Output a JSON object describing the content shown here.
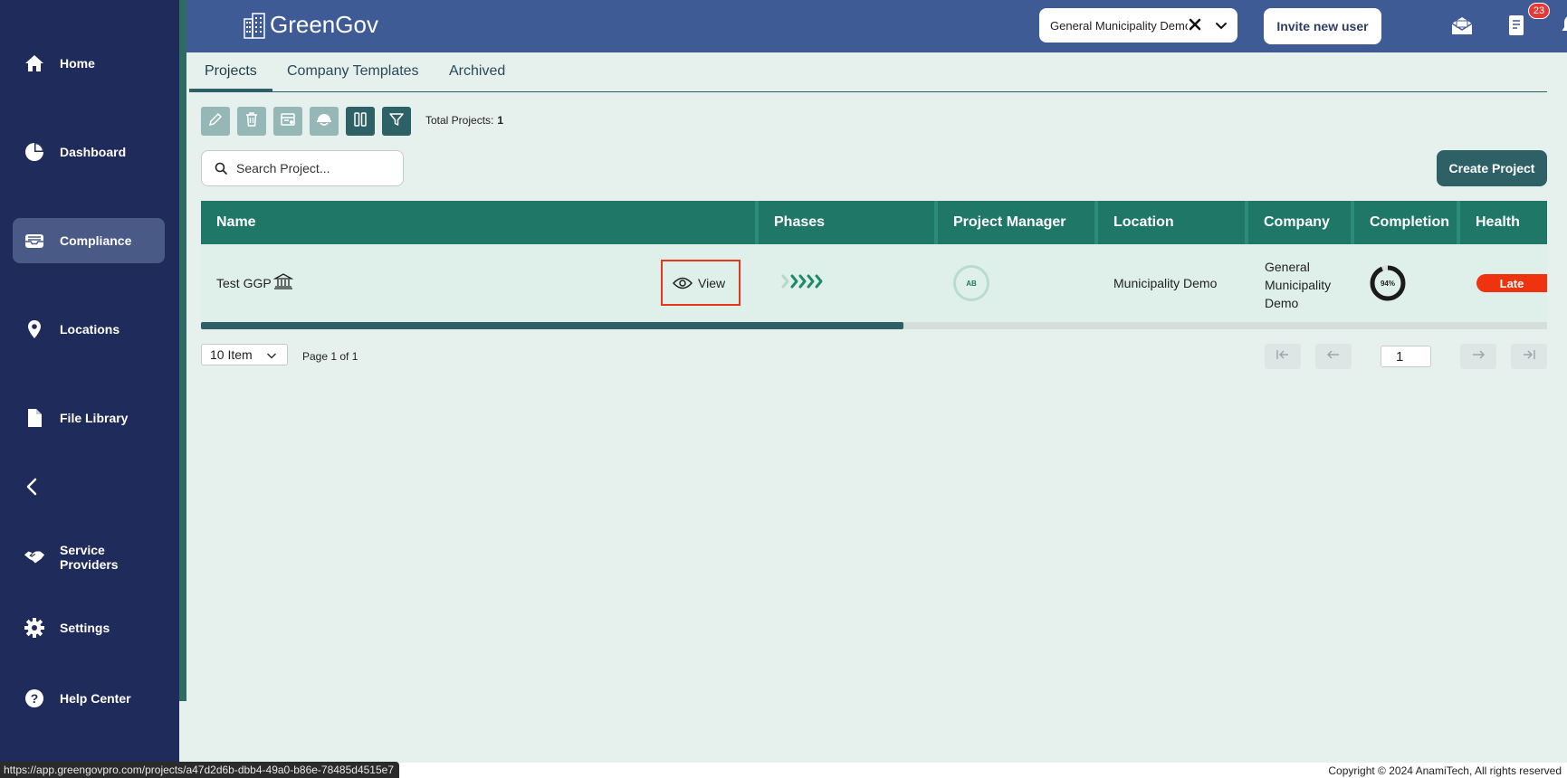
{
  "sidebar": {
    "items": [
      {
        "label": "Home",
        "icon": "home-icon"
      },
      {
        "label": "Dashboard",
        "icon": "pie-chart-icon"
      },
      {
        "label": "Compliance",
        "icon": "inbox-tray-icon"
      },
      {
        "label": "Locations",
        "icon": "map-pin-icon"
      },
      {
        "label": "File Library",
        "icon": "file-icon"
      },
      {
        "label": "Service Providers",
        "icon": "handshake-icon"
      },
      {
        "label": "Settings",
        "icon": "gear-icon"
      },
      {
        "label": "Help Center",
        "icon": "help-circle-icon"
      }
    ],
    "active": "Compliance"
  },
  "header": {
    "logo_text": "GreenGov",
    "org_select_value": "General Municipality Demo",
    "invite_label": "Invite new user",
    "notification_count": "23"
  },
  "tabs": [
    "Projects",
    "Company Templates",
    "Archived"
  ],
  "toolbar": {
    "total_label": "Total Projects:",
    "total_value": "1"
  },
  "search": {
    "placeholder": "Search Project..."
  },
  "create_label": "Create Project",
  "table": {
    "columns": [
      "Name",
      "Phases",
      "Project Manager",
      "Location",
      "Company",
      "Completion",
      "Health"
    ],
    "rows": [
      {
        "name": "Test GGP",
        "view_label": "View",
        "manager_initials": "AB",
        "location": "Municipality Demo",
        "company": [
          "General",
          "Municipality",
          "Demo"
        ],
        "completion": "94%",
        "completion_value": 94,
        "health": "Late"
      }
    ]
  },
  "pagination": {
    "page_size": "10 Item",
    "page_info": "Page 1 of 1",
    "current_page": "1"
  },
  "status_url": "https://app.greengovpro.com/projects/a47d2d6b-dbb4-49a0-b86e-78485d4515e7",
  "copyright": "Copyright © 2024 AnamiTech, All rights reserved",
  "colors": {
    "sidebar": "#1f2b5a",
    "header": "#3f5b96",
    "table_header": "#1f7768",
    "accent": "#2e6166",
    "late": "#f0330f"
  }
}
